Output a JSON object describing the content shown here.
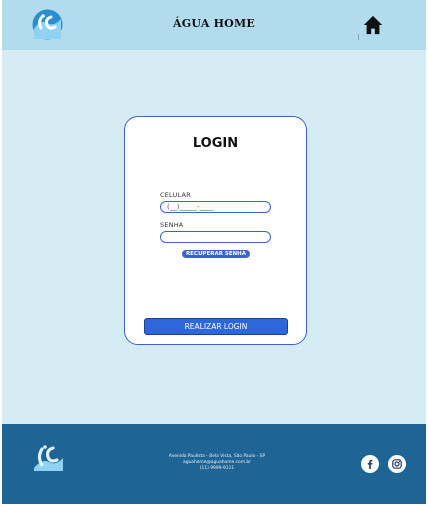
{
  "header": {
    "title": "ÁGUA HOME",
    "home_icon": "home-icon",
    "logo_icon": "wave-logo-icon"
  },
  "login": {
    "title": "LOGIN",
    "phone_label": "CELULAR",
    "phone_placeholder": "(__)_____-____",
    "password_label": "SENHA",
    "password_value": "",
    "recover_label": "RECUPERAR SENHA",
    "submit_label": "REALIZAR LOGIN"
  },
  "footer": {
    "address": "Avenida Paulista - Bela Vista, São Paulo - SP",
    "email": "aguahome@aguahome.com.br",
    "phone": "(11) 9999-9111",
    "social": [
      {
        "icon": "facebook-icon"
      },
      {
        "icon": "instagram-icon"
      }
    ]
  },
  "colors": {
    "header_bg": "#b2dcee",
    "page_bg": "#d6ecf5",
    "accent": "#3b63c9",
    "button": "#2e66dc",
    "footer_bg": "#1e6494"
  }
}
